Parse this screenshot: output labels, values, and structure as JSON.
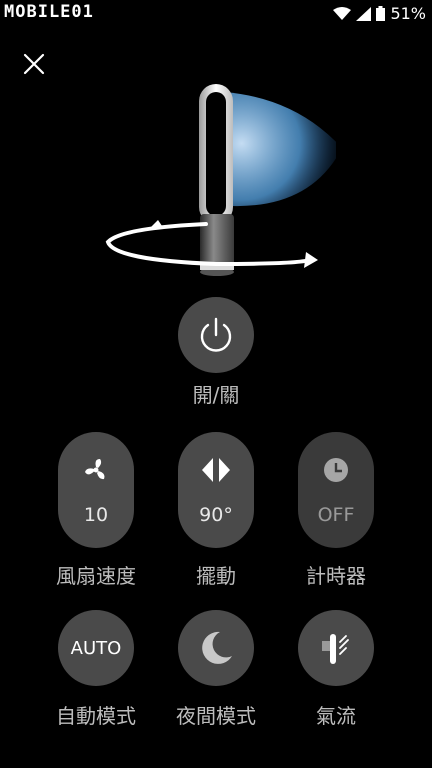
{
  "status": {
    "watermark": "MOBILE01",
    "battery": "51%"
  },
  "power": {
    "label": "開/關"
  },
  "controls": [
    {
      "label": "風扇速度",
      "value": "10"
    },
    {
      "label": "擺動",
      "value": "90°"
    },
    {
      "label": "計時器",
      "value": "OFF"
    }
  ],
  "modes": [
    {
      "label": "自動模式",
      "value": "AUTO"
    },
    {
      "label": "夜間模式"
    },
    {
      "label": "氣流"
    }
  ],
  "icons": {
    "close": "close-icon",
    "power": "power-icon",
    "fan": "fan-icon",
    "oscillation": "oscillation-icon",
    "timer": "clock-icon",
    "night": "moon-icon",
    "airflow": "airflow-icon"
  },
  "colors": {
    "background": "#000000",
    "button": "#4a4a4a",
    "label": "#bdbdbd",
    "accent": "#5fb3ff"
  }
}
